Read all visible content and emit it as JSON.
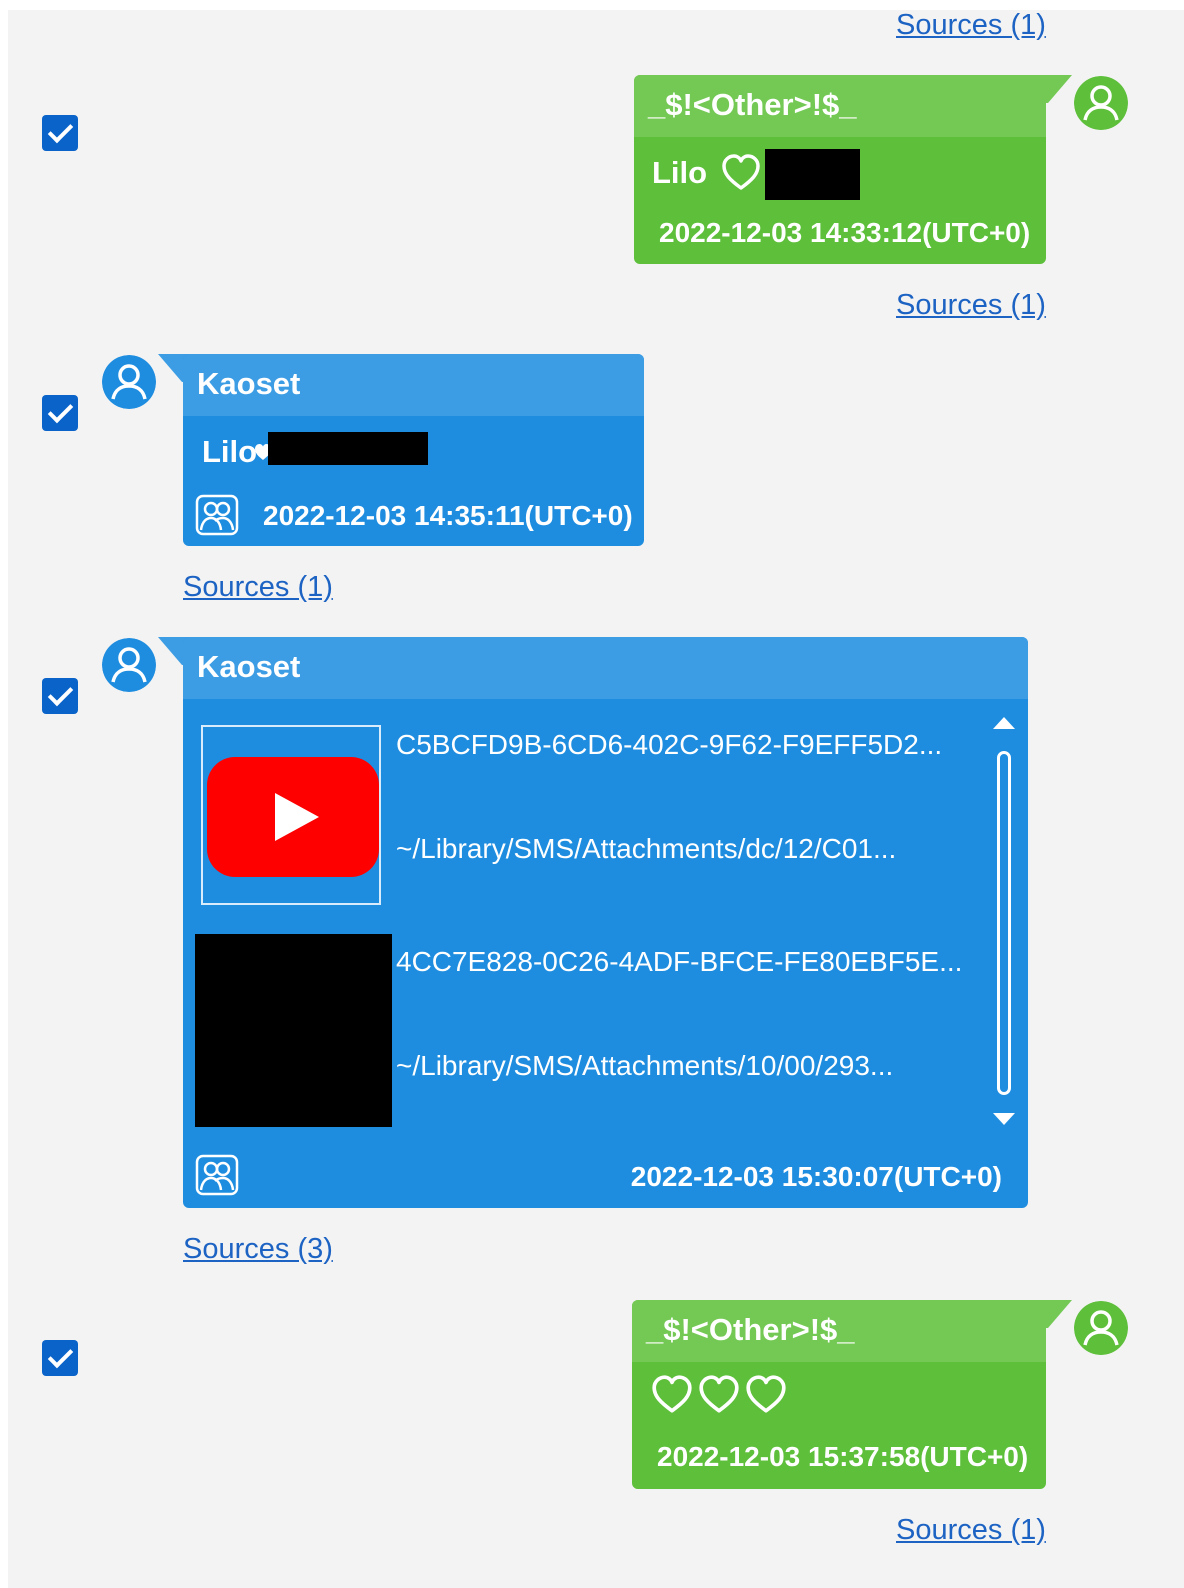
{
  "colors": {
    "green_bubble": "#5dbf3a",
    "green_header": "#74c955",
    "blue_bubble": "#1e8de0",
    "blue_header": "#3d9de4",
    "link": "#1d63c3",
    "checkbox": "#0a63c9"
  },
  "top_sources": "Sources (1)",
  "messages": [
    {
      "direction": "outgoing",
      "checked": true,
      "sender": "_$!<Other>!$_",
      "text": "Lilo",
      "text_icons": [
        "heart-outline-icon"
      ],
      "redacted": true,
      "timestamp": "2022-12-03 14:33:12(UTC+0)",
      "sources": "Sources (1)",
      "avatar": "user-icon"
    },
    {
      "direction": "incoming",
      "checked": true,
      "sender": "Kaoset",
      "text": "Lilo",
      "text_icons": [
        "heart-icon"
      ],
      "redacted": true,
      "timestamp": "2022-12-03 14:35:11(UTC+0)",
      "sources": "Sources (1)",
      "avatar": "user-icon"
    },
    {
      "direction": "incoming",
      "checked": true,
      "sender": "Kaoset",
      "attachments": [
        {
          "name": "C5BCFD9B-6CD6-402C-9F62-F9EFF5D2...",
          "path": "~/Library/SMS/Attachments/dc/12/C01...",
          "thumbnail": "youtube-play-icon"
        },
        {
          "name": "4CC7E828-0C26-4ADF-BFCE-FE80EBF5E...",
          "path": "~/Library/SMS/Attachments/10/00/293...",
          "thumbnail": "redacted"
        }
      ],
      "timestamp": "2022-12-03 15:30:07(UTC+0)",
      "sources": "Sources (3)",
      "avatar": "user-icon"
    },
    {
      "direction": "outgoing",
      "checked": true,
      "sender": "_$!<Other>!$_",
      "text_icons": [
        "heart-outline-icon",
        "heart-outline-icon",
        "heart-outline-icon"
      ],
      "timestamp": "2022-12-03 15:37:58(UTC+0)",
      "sources": "Sources (1)",
      "avatar": "user-icon"
    }
  ]
}
